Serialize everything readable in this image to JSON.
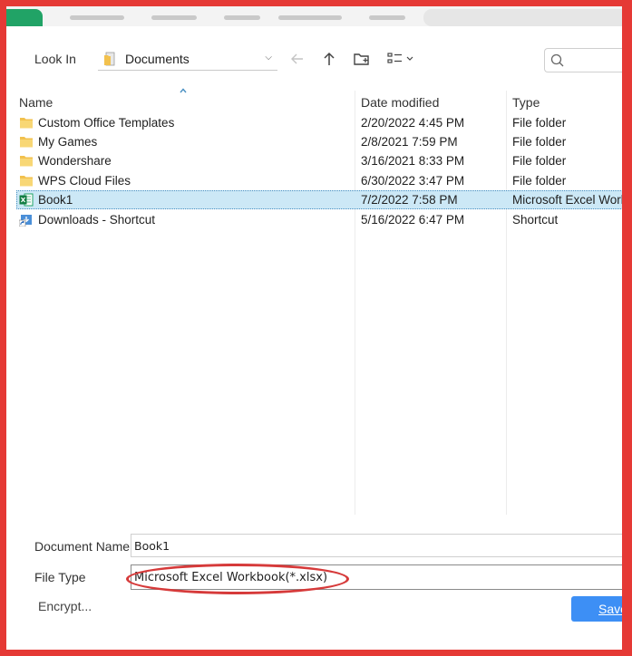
{
  "toolbar": {
    "look_in_label": "Look In",
    "current_folder": "Documents",
    "back_icon": "arrow-left-icon",
    "up_icon": "arrow-up-icon",
    "new_folder_icon": "new-folder-icon",
    "view_icon": "view-list-icon",
    "search_icon": "search-icon"
  },
  "columns": {
    "name": "Name",
    "date": "Date modified",
    "type": "Type"
  },
  "files": [
    {
      "name": "Custom Office Templates",
      "date": "2/20/2022 4:45 PM",
      "type": "File folder",
      "icon": "folder-icon"
    },
    {
      "name": "My Games",
      "date": "2/8/2021 7:59 PM",
      "type": "File folder",
      "icon": "folder-icon"
    },
    {
      "name": "Wondershare",
      "date": "3/16/2021 8:33 PM",
      "type": "File folder",
      "icon": "folder-icon"
    },
    {
      "name": "WPS Cloud Files",
      "date": "6/30/2022 3:47 PM",
      "type": "File folder",
      "icon": "folder-icon"
    },
    {
      "name": "Book1",
      "date": "7/2/2022 7:58 PM",
      "type": "Microsoft Excel Workbook",
      "icon": "excel-file-icon",
      "selected": true
    },
    {
      "name": "Downloads - Shortcut",
      "date": "5/16/2022 6:47 PM",
      "type": "Shortcut",
      "icon": "shortcut-icon"
    }
  ],
  "form": {
    "document_name_label": "Document Name",
    "document_name_value": "Book1",
    "file_type_label": "File Type",
    "file_type_value": "Microsoft Excel Workbook(*.xlsx)",
    "encrypt_label": "Encrypt...",
    "save_label": "Save"
  },
  "colors": {
    "annotation_red": "#e53935",
    "selection": "#cce8f6",
    "save_button": "#3d8ff5",
    "folder": "#f2c14e"
  }
}
